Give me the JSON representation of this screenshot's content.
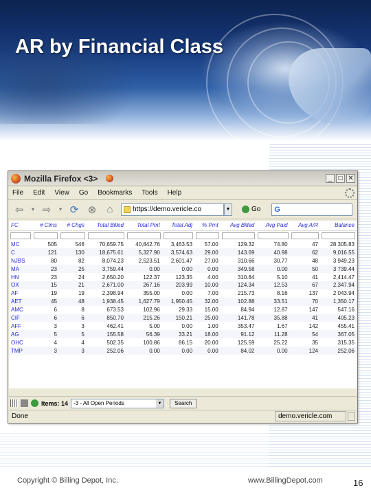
{
  "slide": {
    "title": "AR by Financial Class",
    "copyright": "Copyright © Billing Depot, Inc.",
    "website": "www.BillingDepot.com",
    "page_number": "16"
  },
  "browser": {
    "title": "Mozilla Firefox <3>",
    "menu": [
      "File",
      "Edit",
      "View",
      "Go",
      "Bookmarks",
      "Tools",
      "Help"
    ],
    "url": "https://demo.vericle.co",
    "go_label": "Go",
    "search_icon": "G",
    "status": "Done",
    "status_host": "demo.vericle.com"
  },
  "table": {
    "columns": [
      "FC",
      "# Clms",
      "# Chgs",
      "Total Billed",
      "Total Pmt",
      "Total Adj",
      "% Pmt",
      "Avg Billed",
      "Avg Paid",
      "Avg A/R",
      "Balance"
    ],
    "rows": [
      [
        "MC",
        "505",
        "546",
        "70,659.75",
        "40,842.76",
        "3,463.53",
        "57.00",
        "129.32",
        "74.80",
        "47",
        "28 305.83"
      ],
      [
        "C",
        "121",
        "130",
        "18,675.61",
        "5,327.90",
        "3,574.63",
        "29.00",
        "143.69",
        "40.98",
        "62",
        "9,016.55"
      ],
      [
        "NJBS",
        "80",
        "82",
        "8,074.23",
        "2,523.51",
        "2,601.47",
        "27.00",
        "310.66",
        "30.77",
        "48",
        "3 949.23"
      ],
      [
        "MA",
        "23",
        "25",
        "3,759.44",
        "0.00",
        "0.00",
        "0.00",
        "349.58",
        "0.00",
        "50",
        "3 739.44"
      ],
      [
        "HN",
        "23",
        "24",
        "2,650.20",
        "122.37",
        "123.35",
        "4.00",
        "310.84",
        "5.10",
        "41",
        "2,414.47"
      ],
      [
        "OX",
        "15",
        "21",
        "2,671.00",
        "267.16",
        "203.99",
        "10.00",
        "124.34",
        "12.53",
        "67",
        "2,347.94"
      ],
      [
        "AF",
        "19",
        "19",
        "2,398.94",
        "355.00",
        "0.00",
        "7.00",
        "215.73",
        "8.16",
        "137",
        "2 043.94"
      ],
      [
        "AET",
        "45",
        "48",
        "1,938.45",
        "1,627.79",
        "1,950.45",
        "32.00",
        "102.88",
        "33.51",
        "70",
        "1,350.17"
      ],
      [
        "AMC",
        "6",
        "8",
        "673.53",
        "102.96",
        "29.33",
        "15.00",
        "84.94",
        "12.87",
        "147",
        "547.16"
      ],
      [
        "CIF",
        "6",
        "6",
        "850.70",
        "215.26",
        "150.21",
        "25.00",
        "141.78",
        "35.88",
        "41",
        "405.23"
      ],
      [
        "AFF",
        "3",
        "3",
        "462.41",
        "5.00",
        "0.00",
        "1.00",
        "353.47",
        "1.67",
        "142",
        "455.41"
      ],
      [
        "AG",
        "5",
        "5",
        "155.58",
        "56.39",
        "33.21",
        "18.00",
        "91.12",
        "11.28",
        "54",
        "367.05"
      ],
      [
        "OHC",
        "4",
        "4",
        "502.35",
        "100.86",
        "86.15",
        "20.00",
        "125.59",
        "25.22",
        "35",
        "315.35"
      ],
      [
        "TMP",
        "3",
        "3",
        "252.06",
        "0.00",
        "0.00",
        "0.00",
        "84.02",
        "0.00",
        "124",
        "252.06"
      ]
    ]
  },
  "findbar": {
    "items_label": "Items: 14",
    "period": "-3 - All Open Periods",
    "search_label": "Search"
  }
}
